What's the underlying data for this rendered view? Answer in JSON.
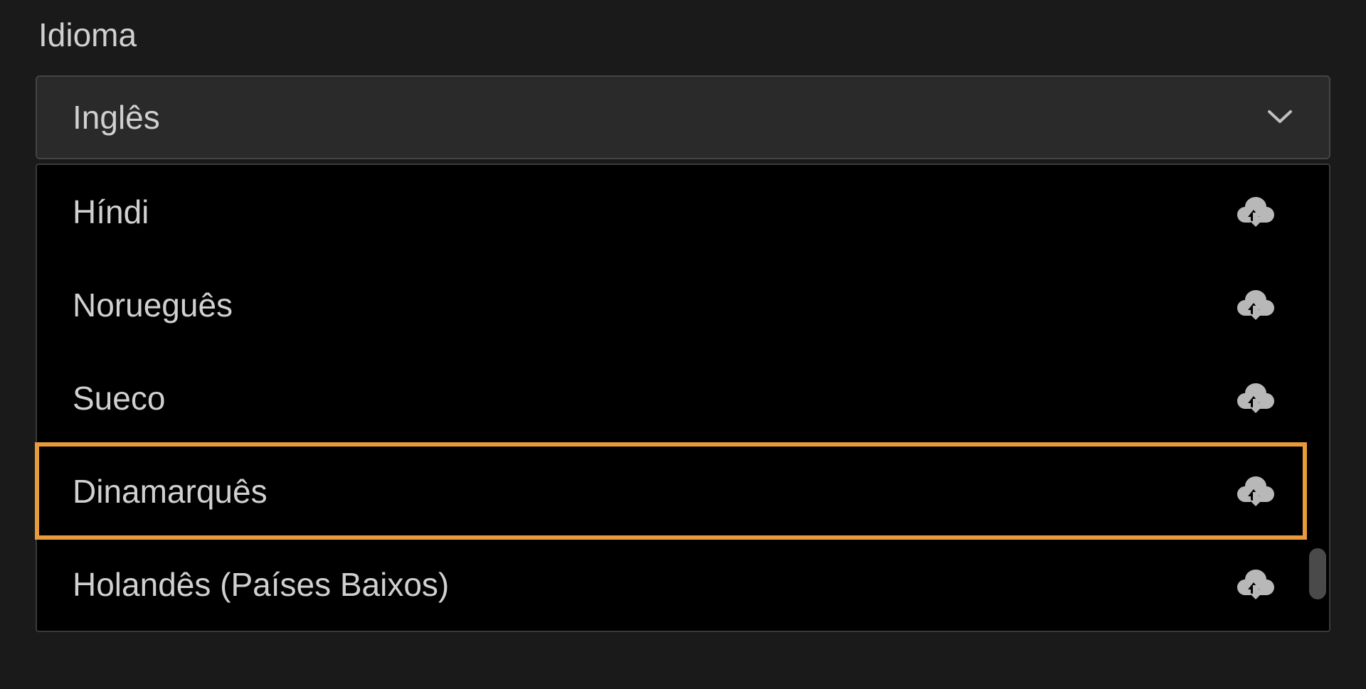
{
  "language_section": {
    "label": "Idioma",
    "selected": "Inglês",
    "options": [
      {
        "label": "Híndi",
        "downloadable": true,
        "highlighted": false
      },
      {
        "label": "Norueguês",
        "downloadable": true,
        "highlighted": false
      },
      {
        "label": "Sueco",
        "downloadable": true,
        "highlighted": false
      },
      {
        "label": "Dinamarquês",
        "downloadable": true,
        "highlighted": true
      },
      {
        "label": "Holandês (Países Baixos)",
        "downloadable": true,
        "highlighted": false
      }
    ]
  }
}
